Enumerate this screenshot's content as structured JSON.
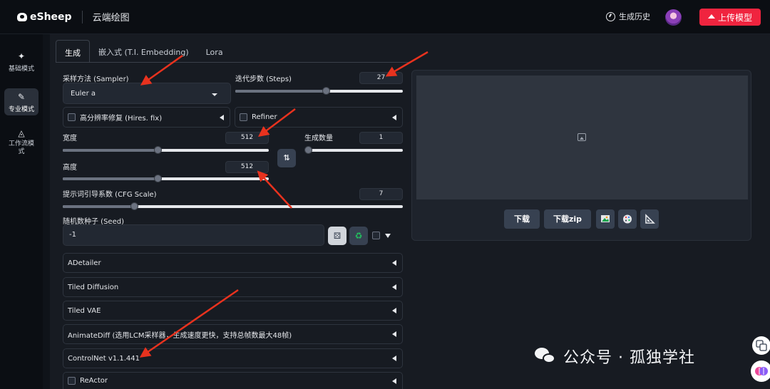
{
  "brand": {
    "logo_text": "eSheep",
    "app_title": "云端绘图"
  },
  "header": {
    "history_label": "生成历史",
    "upload_label": "上传模型"
  },
  "sidebar": {
    "items": [
      {
        "label": "基础模式",
        "icon": "sparkle-icon"
      },
      {
        "label": "专业模式",
        "icon": "brush-icon",
        "active": true
      },
      {
        "label": "工作流模式",
        "icon": "workflow-icon"
      }
    ]
  },
  "tabs": [
    "生成",
    "嵌入式 (T.I. Embedding)",
    "Lora"
  ],
  "form": {
    "sampler_label": "采样方法 (Sampler)",
    "sampler_value": "Euler a",
    "steps_label": "迭代步数 (Steps)",
    "steps_value": "27",
    "steps_level": 0.54,
    "hires_label": "高分辨率修复 (Hires. fix)",
    "refiner_label": "Refiner",
    "width_label": "宽度",
    "width_value": "512",
    "width_level": 0.46,
    "height_label": "高度",
    "height_value": "512",
    "height_level": 0.46,
    "batch_label": "生成数量",
    "batch_value": "1",
    "batch_level": 0.0,
    "swap_label": "⇅",
    "cfg_label": "提示词引导系数 (CFG Scale)",
    "cfg_value": "7",
    "cfg_level": 0.21,
    "seed_label": "随机数种子 (Seed)",
    "seed_value": "-1"
  },
  "accordions": [
    "ADetailer",
    "Tiled Diffusion",
    "Tiled VAE",
    "AnimateDiff (选用LCM采样器，生成速度更快，支持总帧数最大48帧)",
    "ControlNet v1.1.441",
    "ReActor"
  ],
  "output": {
    "download_label": "下载",
    "download_zip_label": "下载zip"
  },
  "watermark": "公众号 · 孤独学社",
  "colors": {
    "accent": "#f0243f",
    "arrow": "#e8321e",
    "panel": "#171b22"
  }
}
